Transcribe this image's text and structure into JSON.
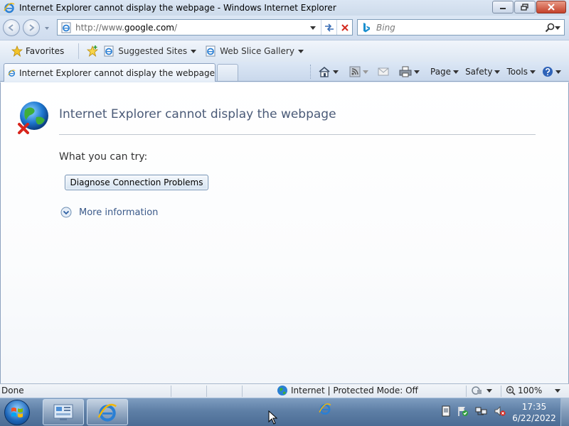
{
  "window": {
    "title": "Internet Explorer cannot display the webpage - Windows Internet Explorer",
    "controls": [
      "minimize",
      "maximize",
      "close"
    ]
  },
  "address": {
    "url_prefix": "http://www.",
    "url_host": "google.com",
    "url_suffix": "/"
  },
  "search": {
    "placeholder": "Bing"
  },
  "favorites_bar": {
    "favorites_label": "Favorites",
    "items": [
      {
        "label": "Suggested Sites"
      },
      {
        "label": "Web Slice Gallery"
      }
    ]
  },
  "tabs": [
    {
      "label": "Internet Explorer cannot display the webpage",
      "active": true
    }
  ],
  "command_bar": {
    "page_label": "Page",
    "safety_label": "Safety",
    "tools_label": "Tools"
  },
  "error_page": {
    "title": "Internet Explorer cannot display the webpage",
    "try_label": "What you can try:",
    "diagnose_button": "Diagnose Connection Problems",
    "more_info": "More information"
  },
  "status_bar": {
    "status": "Done",
    "zone": "Internet | Protected Mode: Off",
    "zoom": "100%"
  },
  "taskbar": {
    "time": "17:35",
    "date": "6/22/2022"
  },
  "colors": {
    "title_text": "#4a5a77",
    "link": "#3b5a8a",
    "taskbar": "#5e7fa6"
  }
}
